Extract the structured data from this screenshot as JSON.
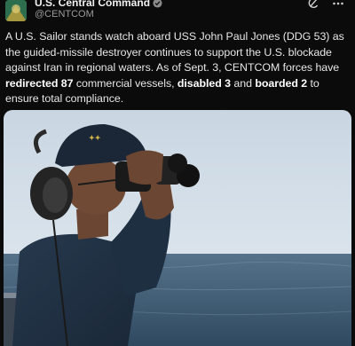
{
  "account": {
    "name": "U.S. Central Command",
    "handle": "@CENTCOM",
    "avatar_icon": "centcom-seal-icon",
    "verified_icon": "verified-badge-icon"
  },
  "toolbar": {
    "grok_icon": "grok-icon",
    "more_icon": "more-dots-icon"
  },
  "post": {
    "text_parts": [
      {
        "t": "A U.S. Sailor stands watch aboard USS John Paul Jones (DDG 53) as the guided-missile destroyer continues to support the U.S. blockade against Iran in regional waters. As of Sept. 3, CENTCOM forces have ",
        "bold": false
      },
      {
        "t": "redirected 87",
        "bold": true
      },
      {
        "t": " commercial vessels, ",
        "bold": false
      },
      {
        "t": "disabled 3",
        "bold": true
      },
      {
        "t": " and ",
        "bold": false
      },
      {
        "t": "boarded 2",
        "bold": true
      },
      {
        "t": " to ensure total compliance.",
        "bold": false
      }
    ]
  },
  "media": {
    "description_icon": "sailor-with-binoculars-photo"
  },
  "colors": {
    "background": "#0b0b0b",
    "text": "#e6e6e6",
    "handle": "#9a9a9a",
    "verified": "#8a8a8a"
  }
}
